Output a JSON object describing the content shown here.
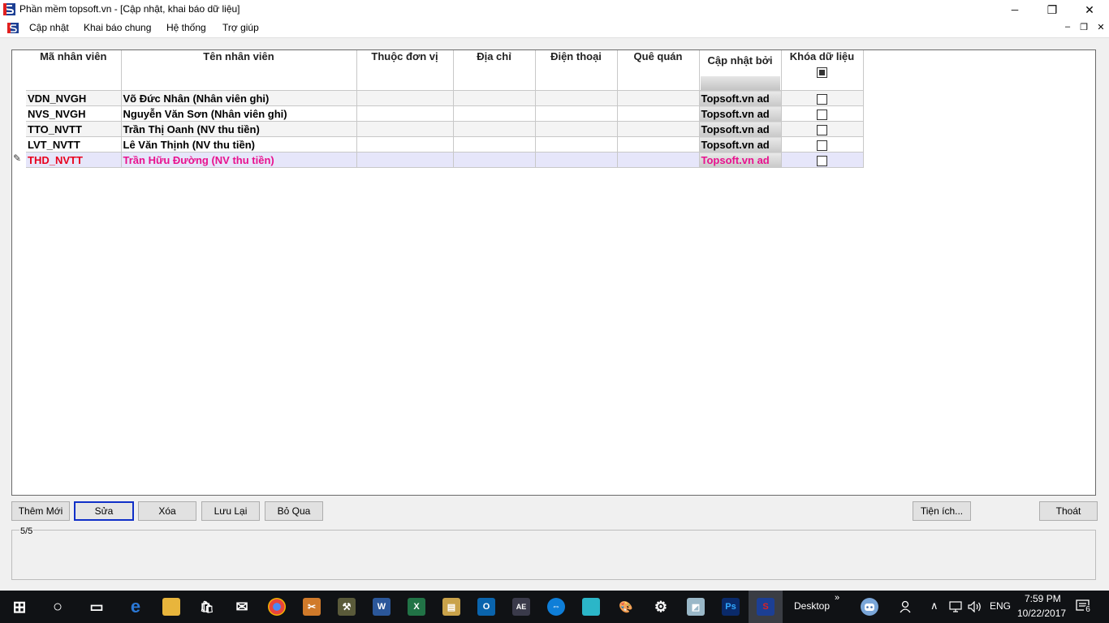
{
  "window": {
    "title": "Phần mềm topsoft.vn - [Cập nhật, khai báo dữ liệu]",
    "minimize": "─",
    "restore": "❐",
    "close": "✕"
  },
  "menu": {
    "items": [
      "Cập nhật",
      "Khai báo chung",
      "Hệ thống",
      "Trợ giúp"
    ],
    "mdi_min": "–",
    "mdi_restore": "❐",
    "mdi_close": "✕"
  },
  "grid": {
    "columns": [
      "Mã nhân viên",
      "Tên nhân viên",
      "Thuộc đơn vị",
      "Địa chỉ",
      "Điện thoại",
      "Quê quán",
      "Cập nhật bởi",
      "Khóa dữ liệu"
    ],
    "rows": [
      {
        "code": "VDN_NVGH",
        "name": "Võ Đức Nhân (Nhân viên ghi)",
        "unit": "",
        "address": "",
        "phone": "",
        "hometown": "",
        "updated_by": "Topsoft.vn ad",
        "locked": false
      },
      {
        "code": "NVS_NVGH",
        "name": "Nguyễn Văn Sơn (Nhân viên ghi)",
        "unit": "",
        "address": "",
        "phone": "",
        "hometown": "",
        "updated_by": "Topsoft.vn ad",
        "locked": false
      },
      {
        "code": "TTO_NVTT",
        "name": "Trần Thị Oanh (NV thu tiền)",
        "unit": "",
        "address": "",
        "phone": "",
        "hometown": "",
        "updated_by": "Topsoft.vn ad",
        "locked": false
      },
      {
        "code": "LVT_NVTT",
        "name": "Lê Văn Thịnh (NV thu tiền)",
        "unit": "",
        "address": "",
        "phone": "",
        "hometown": "",
        "updated_by": "Topsoft.vn ad",
        "locked": false
      },
      {
        "code": "THD_NVTT",
        "name": "Trần Hữu Đường (NV thu tiền)",
        "unit": "",
        "address": "",
        "phone": "",
        "hometown": "",
        "updated_by": "Topsoft.vn ad",
        "locked": false
      }
    ],
    "selected_row": 4,
    "edit_marker": "✎"
  },
  "buttons": {
    "add": "Thêm Mới",
    "edit": "Sửa",
    "delete": "Xóa",
    "save": "Lưu Lại",
    "skip": "Bỏ Qua",
    "utilities": "Tiện ích...",
    "exit": "Thoát"
  },
  "status": {
    "record": "5/5"
  },
  "taskbar": {
    "desktop_label": "Desktop",
    "chevron": "»",
    "lang": "ENG",
    "time": "7:59 PM",
    "date": "10/22/2017",
    "notif_count": "6",
    "icons": [
      "start-icon",
      "cortana-icon",
      "task-view-icon",
      "edge-icon",
      "file-explorer-icon",
      "store-icon",
      "mail-icon",
      "chrome-icon",
      "tools-icon",
      "toolbox-icon",
      "word-icon",
      "excel-icon",
      "archive-icon",
      "outlook-icon",
      "ae-icon",
      "teamviewer-icon",
      "cube-icon",
      "paint-icon",
      "settings-icon",
      "notes-icon",
      "photoshop-icon",
      "topsoft-icon"
    ]
  },
  "colors": {
    "selected_text": "#e8118e",
    "selected_code": "#e8001c",
    "selected_bg": "#e6e6fa",
    "active_button_border": "#1030c8",
    "taskbar_bg": "#101215"
  }
}
